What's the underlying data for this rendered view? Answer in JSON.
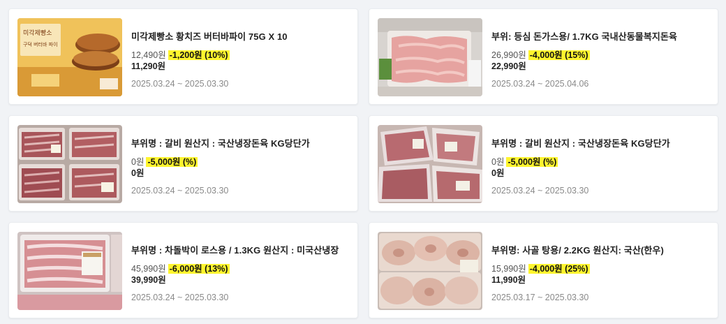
{
  "products": [
    {
      "image": "butter-cheese-pie-box-photo",
      "title": "미각제빵소 황치즈 버터바파이 75G X 10",
      "original_price": "12,490원",
      "discount": "-1,200원 (10%)",
      "final_price": "11,290원",
      "period": "2025.03.24 ~ 2025.03.30",
      "package_text": "미각제빵소",
      "package_sub": "구덕 버터바 파이"
    },
    {
      "image": "pork-loin-cutlet-photo",
      "title": "부위: 등심 돈가스용/ 1.7KG 국내산동물복지돈육",
      "original_price": "26,990원",
      "discount": "-4,000원 (15%)",
      "final_price": "22,990원",
      "period": "2025.03.24 ~ 2025.04.06"
    },
    {
      "image": "pork-ribs-photo",
      "title": "부위명 : 갈비 원산지 : 국산냉장돈육 KG당단가",
      "original_price": "0원",
      "discount": "-5,000원 (%)",
      "final_price": "0원",
      "period": "2025.03.24 ~ 2025.03.30"
    },
    {
      "image": "pork-ribs-packs-photo",
      "title": "부위명 : 갈비 원산지 : 국산냉장돈육 KG당단가",
      "original_price": "0원",
      "discount": "-5,000원 (%)",
      "final_price": "0원",
      "period": "2025.03.24 ~ 2025.03.30"
    },
    {
      "image": "beef-brisket-photo",
      "title": "부위명 : 차돌박이 로스용 / 1.3KG 원산지 : 미국산냉장",
      "original_price": "45,990원",
      "discount": "-6,000원 (13%)",
      "final_price": "39,990원",
      "period": "2025.03.24 ~ 2025.03.30"
    },
    {
      "image": "beef-bone-soup-photo",
      "title": "부위명: 사골 탕용/ 2.2KG 원산지: 국산(한우)",
      "original_price": "15,990원",
      "discount": "-4,000원 (25%)",
      "final_price": "11,990원",
      "period": "2025.03.17 ~ 2025.03.30"
    }
  ],
  "colors": {
    "discount_highlight": "#fff52e",
    "background": "#f1f3f6"
  }
}
